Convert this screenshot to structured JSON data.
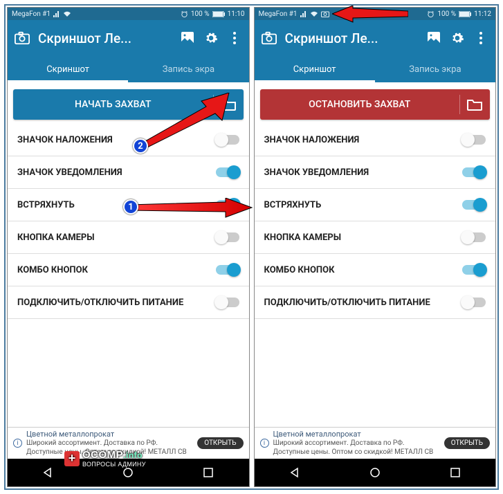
{
  "status": {
    "carrier": "MegaFon #1",
    "battery": "100 %",
    "time_left": "11:10",
    "time_right": "11:12"
  },
  "appbar": {
    "title": "Скриншот Ле..."
  },
  "tabs": {
    "screenshot": "Скриншот",
    "record": "Запись экра"
  },
  "buttons": {
    "start": "НАЧАТЬ ЗАХВАТ",
    "stop": "ОСТАНОВИТЬ ЗАХВАТ"
  },
  "rows": [
    {
      "label": "ЗНАЧОК НАЛОЖЕНИЯ",
      "on": false
    },
    {
      "label": "ЗНАЧОК УВЕДОМЛЕНИЯ",
      "on": true
    },
    {
      "label": "ВСТРЯХНУТЬ",
      "on": true
    },
    {
      "label": "КНОПКА КАМЕРЫ",
      "on": false
    },
    {
      "label": "КОМБО КНОПОК",
      "on": true
    },
    {
      "label": "ПОДКЛЮЧИТЬ/ОТКЛЮЧИТЬ ПИТАНИЕ",
      "on": false
    }
  ],
  "ad": {
    "title": "Цветной металлопрокат",
    "body": "Широкий ассортимент. Доставка по РФ. Доступные цены. Оптом со скидкой! МЕТАЛЛ СВ",
    "cta": "ОТКРЫТЬ"
  },
  "watermark": {
    "brand": "OCOMP",
    "tld": ".info",
    "sub": "ВОПРОСЫ АДМИНУ"
  },
  "badges": {
    "one": "1",
    "two": "2"
  }
}
